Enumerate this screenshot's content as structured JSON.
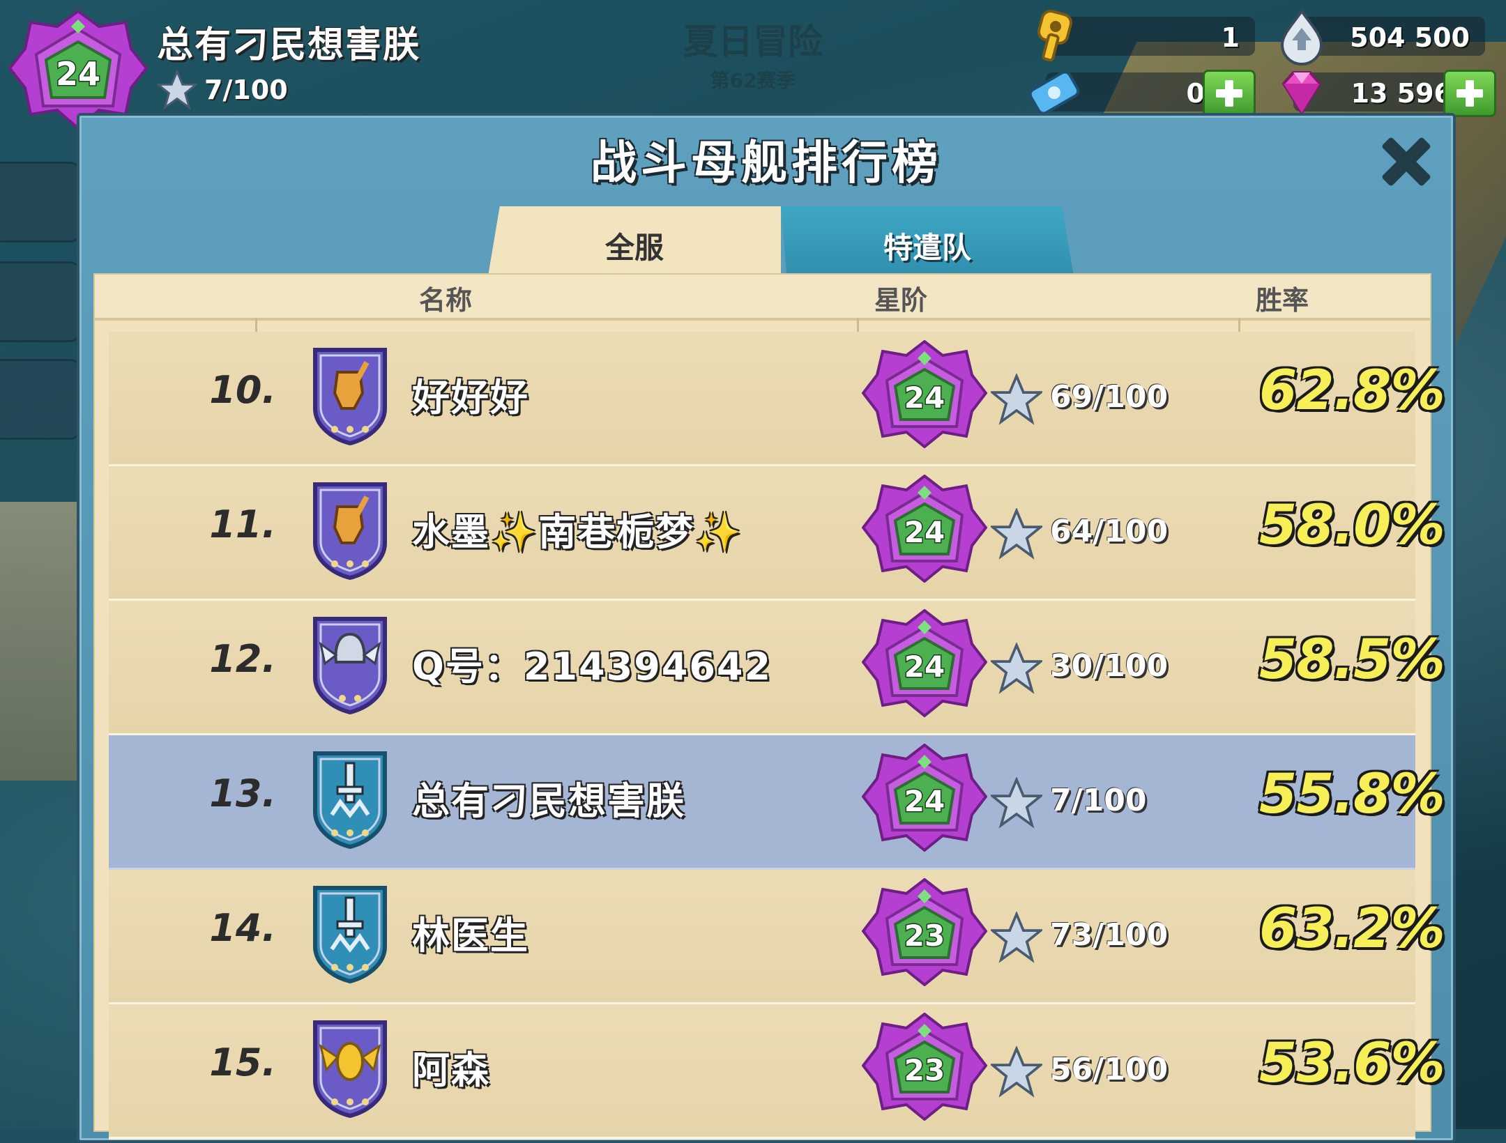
{
  "player": {
    "level": "24",
    "name": "总有刁民想害朕",
    "stars": "7/100"
  },
  "season": {
    "title": "夏日冒险",
    "subtitle": "第62赛季"
  },
  "resources": {
    "keys": "1",
    "gold": "504 500",
    "blueprints": "0",
    "diamonds": "13 596"
  },
  "panel": {
    "title": "战斗母舰排行榜"
  },
  "tabs": {
    "all": "全服",
    "team": "特遣队",
    "active": "all"
  },
  "columns": {
    "name": "名称",
    "rank": "星阶",
    "winrate": "胜率"
  },
  "rows": [
    {
      "rank": "10.",
      "name": "好好好",
      "level": "24",
      "stars": "69/100",
      "winrate": "62.8%",
      "shield": "purple",
      "emblem": "fist-icon"
    },
    {
      "rank": "11.",
      "name": "水墨✨南巷栀梦✨",
      "level": "24",
      "stars": "64/100",
      "winrate": "58.0%",
      "shield": "purple",
      "emblem": "fist-icon"
    },
    {
      "rank": "12.",
      "name": "Q号：214394642",
      "level": "24",
      "stars": "30/100",
      "winrate": "58.5%",
      "shield": "purple",
      "emblem": "helmet-wings-icon"
    },
    {
      "rank": "13.",
      "name": "总有刁民想害朕",
      "level": "24",
      "stars": "7/100",
      "winrate": "55.8%",
      "shield": "blue",
      "emblem": "dagger-icon",
      "highlight": true
    },
    {
      "rank": "14.",
      "name": "林医生",
      "level": "23",
      "stars": "73/100",
      "winrate": "63.2%",
      "shield": "blue",
      "emblem": "dagger-icon"
    },
    {
      "rank": "15.",
      "name": "阿森",
      "level": "23",
      "stars": "56/100",
      "winrate": "53.6%",
      "shield": "purple",
      "emblem": "bomb-wings-icon"
    }
  ],
  "colors": {
    "winrate": "#f7ef57",
    "badge_purple": "#c04fd6",
    "badge_green": "#4caf50",
    "highlight_row": "#a5b6d4"
  }
}
